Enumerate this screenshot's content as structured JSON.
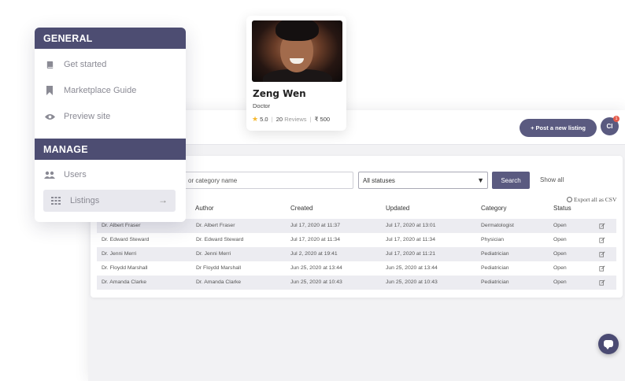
{
  "sidebar": {
    "general_heading": "GENERAL",
    "manage_heading": "MANAGE",
    "general_items": [
      {
        "label": "Get started",
        "icon": "book-icon"
      },
      {
        "label": "Marketplace Guide",
        "icon": "bookmark-icon"
      },
      {
        "label": "Preview site",
        "icon": "eye-icon"
      }
    ],
    "manage_items": [
      {
        "label": "Users",
        "icon": "users-icon"
      },
      {
        "label": "Listings",
        "icon": "grid-icon",
        "active": true,
        "arrow": "→"
      }
    ]
  },
  "profile_card": {
    "name": "Zeng Wen",
    "role": "Doctor",
    "rating": "5.0",
    "reviews_count": "20",
    "reviews_label": "Reviews",
    "price": "₹ 500"
  },
  "topbar": {
    "post_listing_label": "+ Post a new listing",
    "user_initials": "CI",
    "notification_count": "1"
  },
  "filters": {
    "search_value": "or category name",
    "status_value": "All statuses",
    "search_button": "Search",
    "show_all": "Show all",
    "export_label": "Export all as CSV"
  },
  "table": {
    "columns": [
      "Author",
      "Created",
      "Updated",
      "Category",
      "Status"
    ],
    "rows": [
      {
        "name": "Dr. Albert Fraser",
        "author": "Dr. Albert Fraser",
        "created": "Jul 17, 2020 at 11:37",
        "updated": "Jul 17, 2020 at 13:01",
        "category": "Dermatologist",
        "status": "Open"
      },
      {
        "name": "Dr. Edward Steward",
        "author": "Dr. Edward Steward",
        "created": "Jul 17, 2020 at 11:34",
        "updated": "Jul 17, 2020 at 11:34",
        "category": "Physician",
        "status": "Open"
      },
      {
        "name": "Dr. Jenni Merri",
        "author": "Dr. Jenni Merri",
        "created": "Jul 2, 2020 at 19:41",
        "updated": "Jul 17, 2020 at 11:21",
        "category": "Pediatrician",
        "status": "Open"
      },
      {
        "name": "Dr. Floydd Marshall",
        "author": "Dr Floydd Marshall",
        "created": "Jun 25, 2020 at 13:44",
        "updated": "Jun 25, 2020 at 13:44",
        "category": "Pediatrician",
        "status": "Open"
      },
      {
        "name": "Dr. Amanda Clarke",
        "author": "Dr. Amanda Clarke",
        "created": "Jun 25, 2020 at 10:43",
        "updated": "Jun 25, 2020 at 10:43",
        "category": "Pediatrician",
        "status": "Open"
      }
    ]
  },
  "colors": {
    "accent": "#4d4d72",
    "button": "#5a5a80",
    "star": "#f5b82e",
    "badge": "#e55b4b"
  }
}
